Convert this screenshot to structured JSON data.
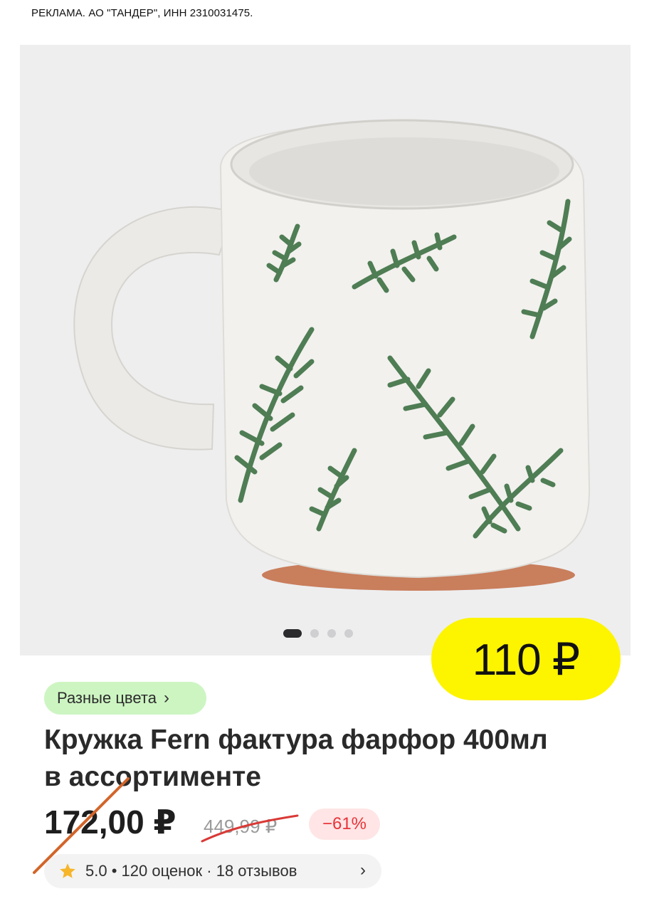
{
  "ad": {
    "label": "РЕКЛАМА. АО \"ТАНДЕР\", ИНН 2310031475."
  },
  "gallery": {
    "slide_count": 4,
    "active_index": 0,
    "image_desc": "product-photo"
  },
  "sticker": {
    "price": "110 ₽",
    "color": "#fdf400"
  },
  "variants": {
    "label": "Разные цвета",
    "chevron": "›"
  },
  "product": {
    "title_line1": "Кружка Fern фактура фарфор 400мл",
    "title_line2": "в ассортименте"
  },
  "pricing": {
    "current": "172,00 ₽",
    "old": "449,99 ₽",
    "discount": "−61%"
  },
  "rating": {
    "summary": "5.0 • 120 оценок · 18 отзывов",
    "icon": "star-icon",
    "chevron": "›"
  },
  "colors": {
    "sticker": "#fdf400",
    "variants_chip": "#cdf5c2",
    "discount_text": "#e8333a",
    "annotation_line": "#d2652a"
  }
}
